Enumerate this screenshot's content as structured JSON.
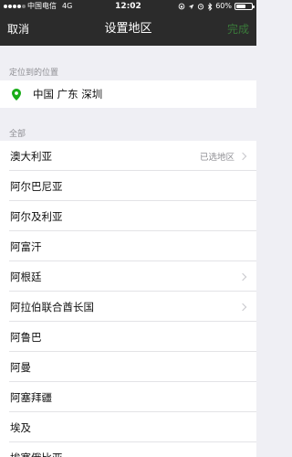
{
  "status_bar": {
    "carrier": "中国电信",
    "network": "4G",
    "time": "12:02",
    "battery_percent": "60%",
    "battery_level": 0.6
  },
  "nav": {
    "cancel_label": "取消",
    "title": "设置地区",
    "done_label": "完成"
  },
  "location_section": {
    "header": "定位到的位置",
    "location": "中国 广东 深圳",
    "icon": "location-pin-icon"
  },
  "all_section": {
    "header": "全部",
    "items": [
      {
        "label": "澳大利亚",
        "status": "已选地区",
        "has_chevron": true
      },
      {
        "label": "阿尔巴尼亚",
        "status": "",
        "has_chevron": false
      },
      {
        "label": "阿尔及利亚",
        "status": "",
        "has_chevron": false
      },
      {
        "label": "阿富汗",
        "status": "",
        "has_chevron": false
      },
      {
        "label": "阿根廷",
        "status": "",
        "has_chevron": true
      },
      {
        "label": "阿拉伯联合酋长国",
        "status": "",
        "has_chevron": true
      },
      {
        "label": "阿鲁巴",
        "status": "",
        "has_chevron": false
      },
      {
        "label": "阿曼",
        "status": "",
        "has_chevron": false
      },
      {
        "label": "阿塞拜疆",
        "status": "",
        "has_chevron": false
      },
      {
        "label": "埃及",
        "status": "",
        "has_chevron": false
      },
      {
        "label": "埃塞俄比亚",
        "status": "",
        "has_chevron": false
      }
    ]
  },
  "colors": {
    "bar_background": "#2b2b2b",
    "done_text": "#3a7a3a",
    "pin": "#1aad19",
    "page_background": "#efeff4"
  }
}
